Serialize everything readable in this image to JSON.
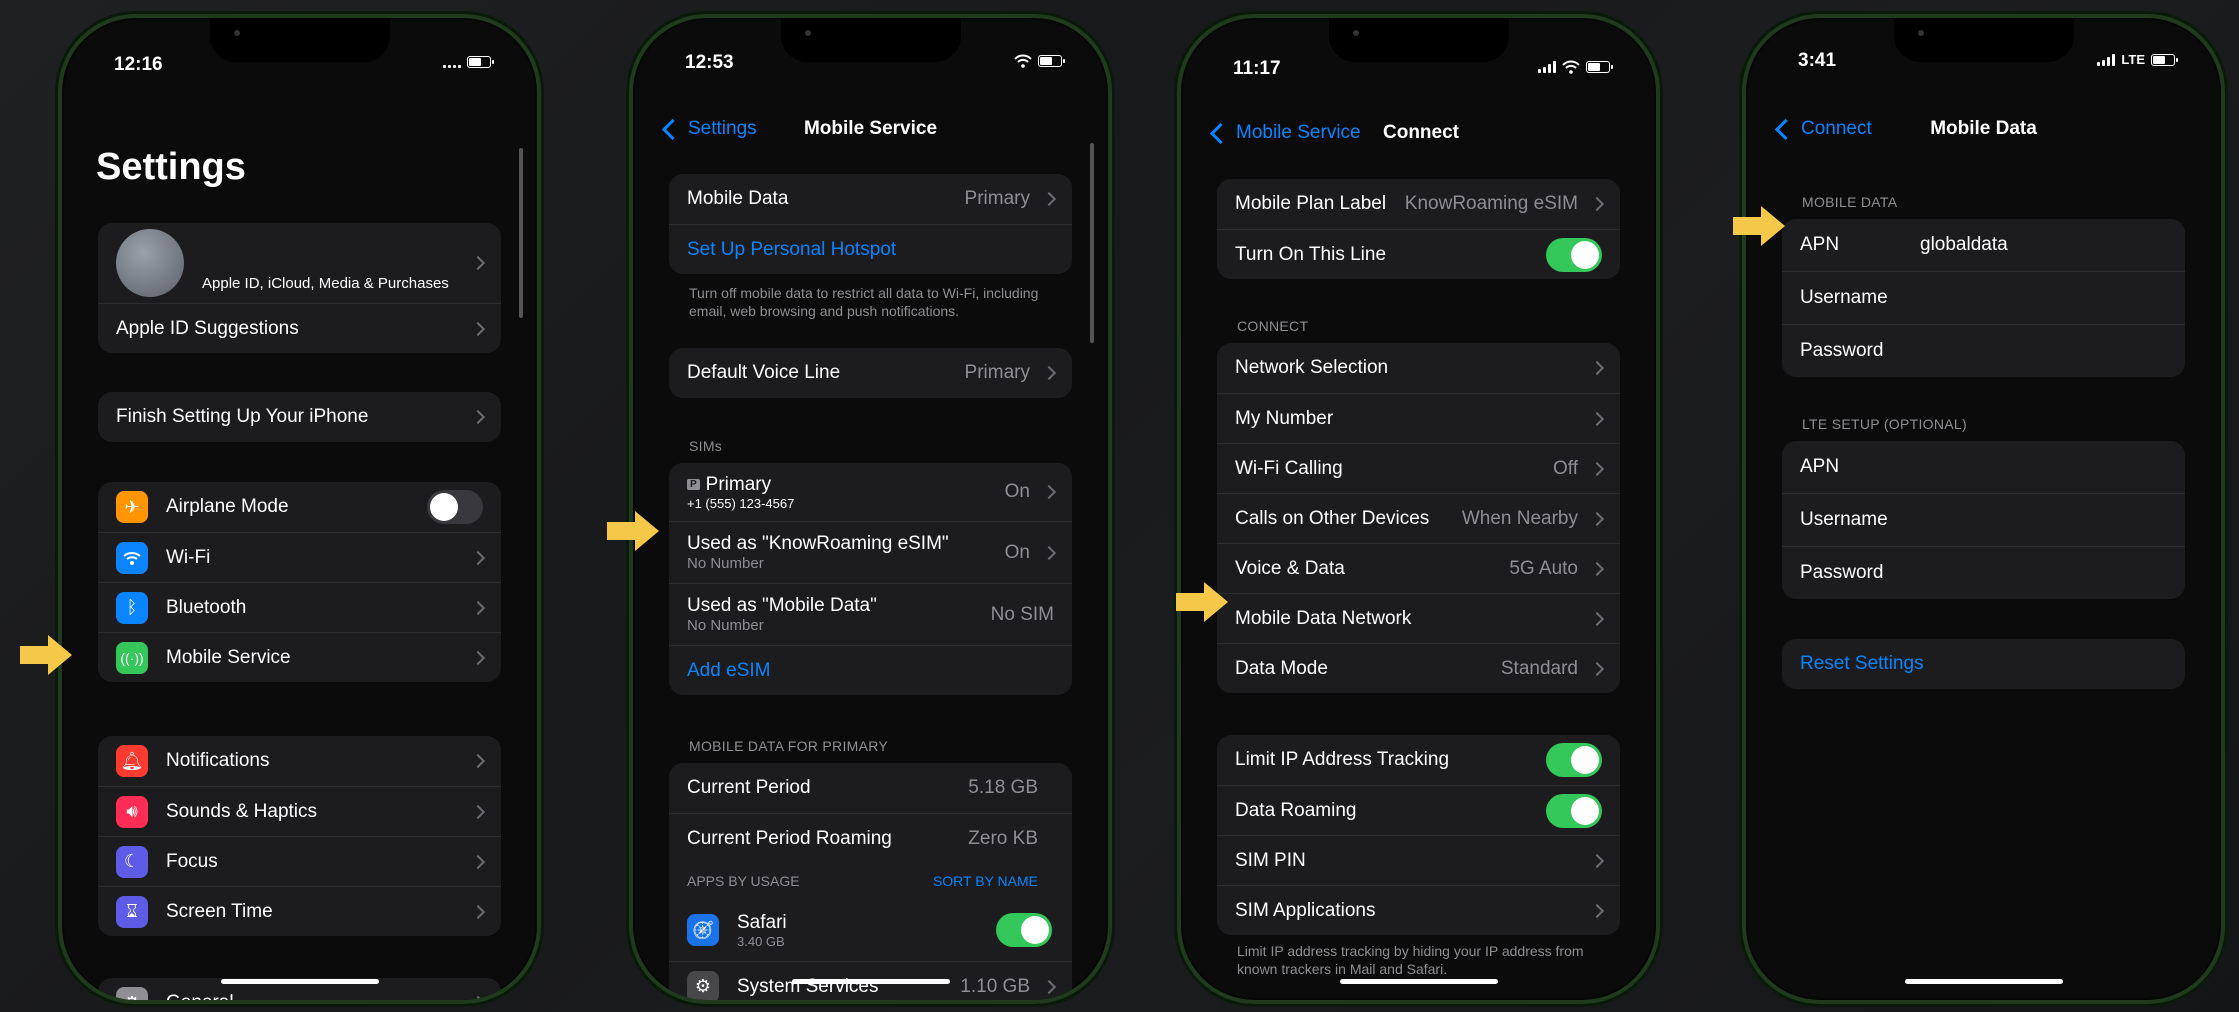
{
  "colors": {
    "accent": "#0a84ff",
    "toggle_on": "#34c759",
    "arrow": "#f5c84a"
  },
  "phones": [
    {
      "time": "12:16",
      "large_title": "Settings",
      "profile": {
        "subtitle": "Apple ID, iCloud, Media & Purchases",
        "suggestions": "Apple ID Suggestions"
      },
      "finish_setup": "Finish Setting Up Your iPhone",
      "group1": [
        {
          "icon": "airplane-icon",
          "label": "Airplane Mode",
          "color": "#ff9500",
          "toggle": "off"
        },
        {
          "icon": "wifi-icon",
          "label": "Wi-Fi",
          "color": "#0a84ff"
        },
        {
          "icon": "bluetooth-icon",
          "label": "Bluetooth",
          "color": "#0a84ff"
        },
        {
          "icon": "antenna-icon",
          "label": "Mobile Service",
          "color": "#34c759"
        }
      ],
      "group2": [
        {
          "icon": "bell-icon",
          "label": "Notifications",
          "color": "#ff3b30"
        },
        {
          "icon": "speaker-icon",
          "label": "Sounds & Haptics",
          "color": "#ff2d55"
        },
        {
          "icon": "moon-icon",
          "label": "Focus",
          "color": "#5e5ce6"
        },
        {
          "icon": "hourglass-icon",
          "label": "Screen Time",
          "color": "#5e5ce6"
        }
      ],
      "general": "General"
    },
    {
      "time": "12:53",
      "back": "Settings",
      "title": "Mobile Service",
      "mobile_data": {
        "label": "Mobile Data",
        "value": "Primary"
      },
      "hotspot": "Set Up Personal Hotspot",
      "footer": "Turn off mobile data to restrict all data to Wi-Fi, including email, web browsing and push notifications.",
      "default_voice": {
        "label": "Default Voice Line",
        "value": "Primary"
      },
      "sims_header": "SIMs",
      "sims": [
        {
          "badge": "P",
          "label": "Primary",
          "sub": "+1 (555) 123-4567",
          "value": "On"
        },
        {
          "label": "Used as \"KnowRoaming eSIM\"",
          "sub": "No Number",
          "value": "On"
        },
        {
          "label": "Used as \"Mobile Data\"",
          "sub": "No Number",
          "value": "No SIM"
        }
      ],
      "add_esim": "Add eSIM",
      "usage_header": "MOBILE DATA FOR PRIMARY",
      "current_period": {
        "label": "Current Period",
        "value": "5.18 GB"
      },
      "current_roaming": {
        "label": "Current Period Roaming",
        "value": "Zero KB"
      },
      "apps_header": "APPS BY USAGE",
      "sort_label": "SORT BY NAME",
      "apps": [
        {
          "name": "Safari",
          "size": "3.40 GB"
        },
        {
          "name": "System Services",
          "value": "1.10 GB"
        }
      ]
    },
    {
      "time": "11:17",
      "back": "Mobile Service",
      "title": "Connect",
      "plan_label": {
        "label": "Mobile Plan Label",
        "value": "KnowRoaming eSIM"
      },
      "turn_on": "Turn On This Line",
      "connect_header": "CONNECT",
      "connect_rows": [
        {
          "label": "Network Selection",
          "value": ""
        },
        {
          "label": "My Number",
          "value": ""
        },
        {
          "label": "Wi-Fi Calling",
          "value": "Off"
        },
        {
          "label": "Calls on Other Devices",
          "value": "When Nearby"
        },
        {
          "label": "Voice & Data",
          "value": "5G Auto"
        },
        {
          "label": "Mobile Data Network",
          "value": ""
        },
        {
          "label": "Data Mode",
          "value": "Standard"
        }
      ],
      "limit_ip": "Limit IP Address Tracking",
      "data_roaming": "Data Roaming",
      "sim_pin": "SIM PIN",
      "sim_apps": "SIM Applications",
      "footer": "Limit IP address tracking by hiding your IP address from known trackers in Mail and Safari."
    },
    {
      "time": "3:41",
      "network": "LTE",
      "back": "Connect",
      "title": "Mobile Data",
      "mobile_data_header": "MOBILE DATA",
      "apn_label": "APN",
      "apn_value": "globaldata",
      "username": "Username",
      "password": "Password",
      "lte_header": "LTE SETUP (OPTIONAL)",
      "lte_rows": [
        "APN",
        "Username",
        "Password"
      ],
      "reset": "Reset Settings"
    }
  ]
}
